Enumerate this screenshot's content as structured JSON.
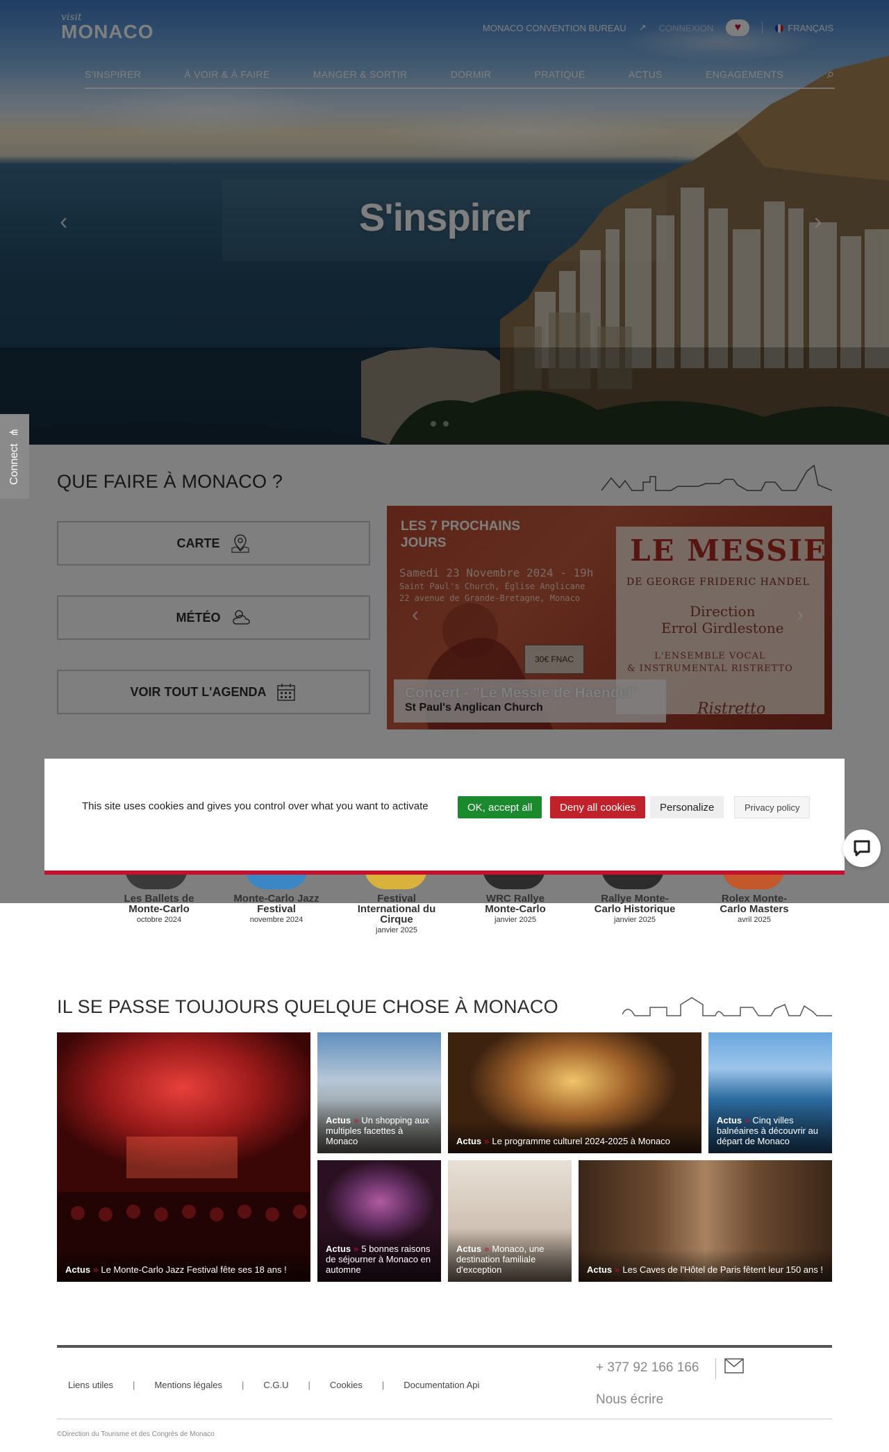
{
  "header": {
    "logo_visit": "visit",
    "logo_monaco": "MONACO",
    "convention_link": "MONACO CONVENTION BUREAU",
    "connect_link": "CONNEXION",
    "language": "FRANÇAIS",
    "nav": [
      "S'INSPIRER",
      "À VOIR & À FAIRE",
      "MANGER & SORTIR",
      "DORMIR",
      "PRATIQUE",
      "ACTUS",
      "ENGAGEMENTS"
    ]
  },
  "hero": {
    "title": "S'inspirer"
  },
  "connect_tab": "Connect",
  "que_faire": {
    "title": "QUE FAIRE À MONACO ?",
    "buttons": [
      {
        "label": "CARTE",
        "icon": "map-pin-icon"
      },
      {
        "label": "MÉTÉO",
        "icon": "weather-icon"
      },
      {
        "label": "VOIR TOUT L'AGENDA",
        "icon": "calendar-icon"
      }
    ],
    "concert": {
      "label_line1": "LES 7 PROCHAINS",
      "label_line2": "JOURS",
      "poster_date": "Samedi 23 Novembre 2024 - 19h",
      "poster_place1": "Saint Paul's Church, Église Anglicane",
      "poster_place2": "22 avenue de Grande-Bretagne, Monaco",
      "poster_title": "LE MESSIE",
      "poster_composer": "DE GEORGE FRIDERIC HANDEL",
      "poster_direction1": "Direction",
      "poster_direction2": "Errol Girdlestone",
      "poster_ensemble1": "L'ENSEMBLE VOCAL",
      "poster_ensemble2": "& INSTRUMENTAL RISTRETTO",
      "poster_price": "30€",
      "poster_ticket": "FNAC",
      "poster_logo": "Ristretto",
      "caption_title": "Concert - \"Le Messie de Haendel\"",
      "caption_place": "St Paul's Anglican Church"
    }
  },
  "events": [
    {
      "name": "Les Ballets de Monte-Carlo",
      "date": "octobre 2024",
      "color": "#3a3a3a"
    },
    {
      "name": "Monte-Carlo Jazz Festival",
      "date": "novembre 2024",
      "color": "#3b87c4"
    },
    {
      "name": "Festival International du Cirque",
      "date": "janvier 2025",
      "color": "#d8b23a"
    },
    {
      "name": "WRC Rallye Monte-Carlo",
      "date": "janvier 2025",
      "color": "#2c2c2c"
    },
    {
      "name": "Rallye Monte-Carlo Historique",
      "date": "janvier 2025",
      "color": "#2c2c2c"
    },
    {
      "name": "Rolex Monte-Carlo Masters",
      "date": "avril 2025",
      "color": "#c4582a"
    }
  ],
  "cookie": {
    "message": "This site uses cookies and gives you control over what you want to activate",
    "accept": "OK, accept all",
    "deny": "Deny all cookies",
    "personalize": "Personalize",
    "privacy": "Privacy policy"
  },
  "news": {
    "title": "IL SE PASSE TOUJOURS QUELQUE CHOSE À MONACO",
    "tag": "Actus",
    "items": [
      {
        "text": "Le Monte-Carlo Jazz Festival fête ses 18 ans !"
      },
      {
        "text": "Un shopping aux multiples facettes à Monaco"
      },
      {
        "text": "Le programme culturel 2024-2025 à Monaco"
      },
      {
        "text": "Cinq villes balnéaires à découvrir au départ de Monaco"
      },
      {
        "text": "5 bonnes raisons de séjourner à Monaco en automne"
      },
      {
        "text": "Monaco, une destination familiale d'exception"
      },
      {
        "text": "Les Caves de l'Hôtel de Paris fêtent leur 150 ans !"
      }
    ]
  },
  "footer": {
    "links": [
      "Liens utiles",
      "Mentions légales",
      "C.G.U",
      "Cookies",
      "Documentation Api"
    ],
    "phone": "+ 377 92 166 166",
    "write": "Nous écrire",
    "copyright": "©Direction du Tourisme et des Congrès de Monaco"
  }
}
